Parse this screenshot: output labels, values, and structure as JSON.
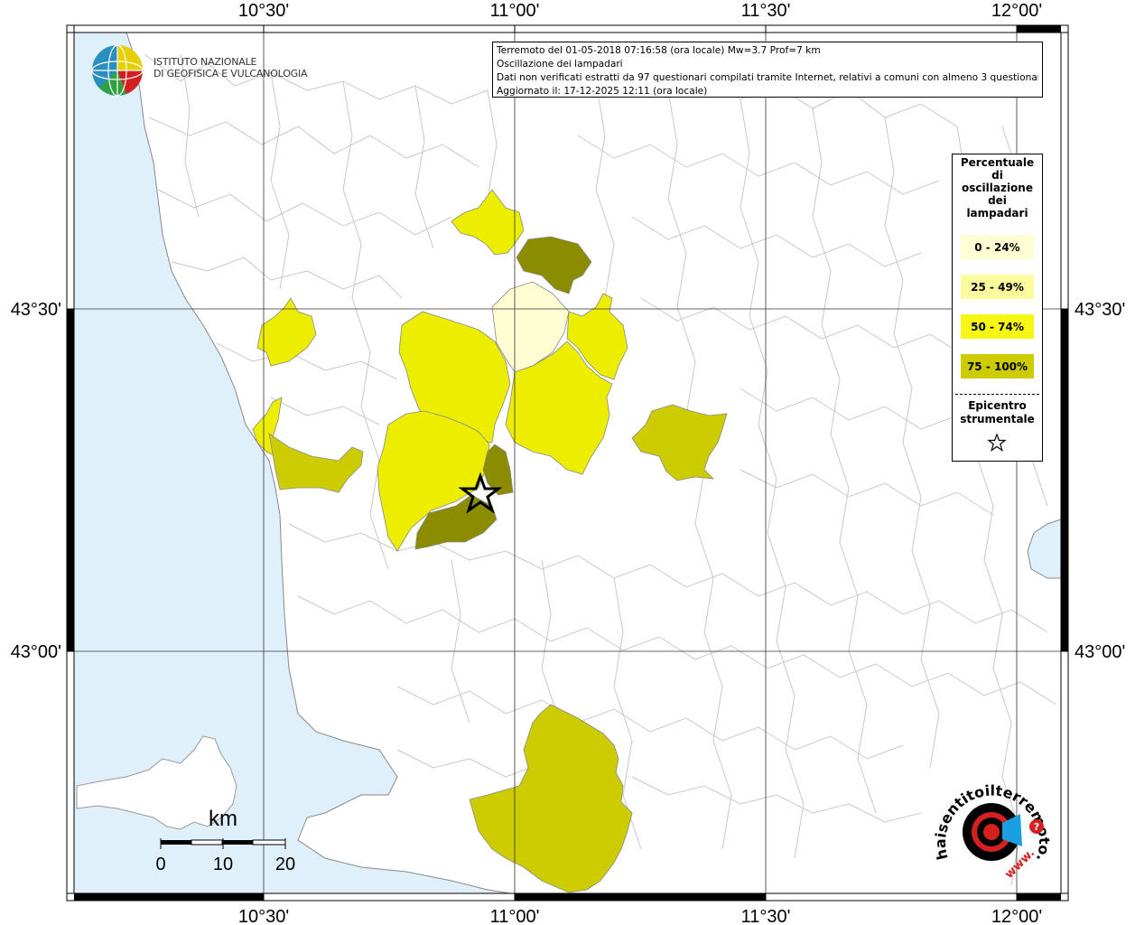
{
  "info": {
    "line1": "Terremoto del 01-05-2018 07:16:58 (ora locale) Mw=3.7 Prof=7 km",
    "line2": "Oscillazione dei lampadari",
    "line3": "Dati non verificati estratti da 97 questionari compilati tramite Internet, relativi a comuni con almeno 3 questionari.",
    "line4": "Aggiornato il: 17-12-2025 12:11 (ora locale)"
  },
  "axes": {
    "lon_labels": [
      "10°30'",
      "11°00'",
      "11°30'",
      "12°00'"
    ],
    "lat_labels": [
      "43°30'",
      "43°00'"
    ]
  },
  "legend": {
    "title_lines": [
      "Percentuale",
      "di",
      "oscillazione",
      "dei",
      "lampadari"
    ],
    "items": [
      {
        "label": "0 - 24%",
        "color": "#fefed2"
      },
      {
        "label": "25 - 49%",
        "color": "#fbfb9d"
      },
      {
        "label": "50 - 74%",
        "color": "#f7f716"
      },
      {
        "label": "75 - 100%",
        "color": "#cccc00"
      }
    ],
    "epicentre_lines": [
      "Epicentro",
      "strumentale"
    ]
  },
  "scale": {
    "unit": "km",
    "ticks": [
      "0",
      "10",
      "20"
    ]
  },
  "logos": {
    "ingv_line1": "ISTITUTO NAZIONALE",
    "ingv_line2": "DI GEOFISICA E VULCANOLOGIA",
    "hsit_text": "haisentitoilterremoto.it",
    "hsit_text2": "www."
  },
  "colors": {
    "sea": "#dff0fb",
    "pale": "#fefed2",
    "yellow": "#eded00",
    "olive": "#cccc00",
    "dark_olive": "#8c8c00"
  }
}
